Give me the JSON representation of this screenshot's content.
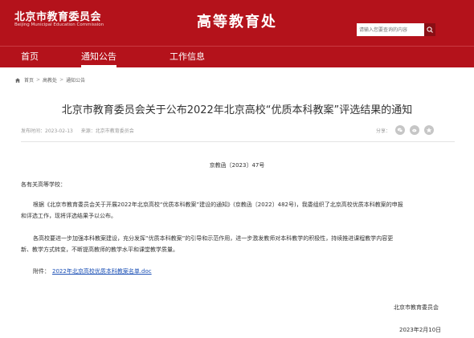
{
  "header": {
    "logo_title": "北京市教育委员会",
    "logo_subtitle": "Beijing Municipal Education Commission",
    "department": "高等教育处",
    "search_placeholder": "请输入您要查询的内容"
  },
  "nav": {
    "items": [
      {
        "label": "首页"
      },
      {
        "label": "通知公告"
      },
      {
        "label": "工作信息"
      }
    ],
    "active_index": 1
  },
  "breadcrumb": {
    "items": [
      "首页",
      "高教处",
      "通知公告"
    ],
    "separator": ">"
  },
  "article": {
    "title": "北京市教育委员会关于公布2022年北京高校“优质本科教案”评选结果的通知",
    "publish_date": "发布时间：2023-02-13",
    "source": "来源：北京市教育委员会",
    "share_label": "分享：",
    "doc_number": "京教函〔2023〕47号",
    "salutation": "各有关高等学校：",
    "para1_line1": "根据《北京市教育委员会关于开展2022年北京高校“优质本科教案”建设的通知》(京教函〔2022〕482号)，我委组织了北京高校优质本科教案的申报",
    "para1_line2": "和评选工作，现将评选结果予以公布。",
    "para2_line1": "各高校要进一步加强本科教案建设，充分发挥“优质本科教案”的引导和示范作用，进一步激发教师对本科教学的积极性，持续推进课程教学内容更",
    "para2_line2": "新、教学方式转变，不断提高教师的教学水平和课堂教学质量。",
    "attachment_label": "附件：",
    "attachment_link": "2022年北京高校优质本科教案名单.doc",
    "signature": "北京市教育委员会",
    "date": "2023年2月10日"
  },
  "colors": {
    "brand_red": "#b4121b",
    "link_blue": "#1a4fb5"
  },
  "icons": {
    "home": "home-icon",
    "search": "search-icon",
    "share": [
      "wechat-icon",
      "weibo-icon",
      "qzone-icon"
    ]
  }
}
